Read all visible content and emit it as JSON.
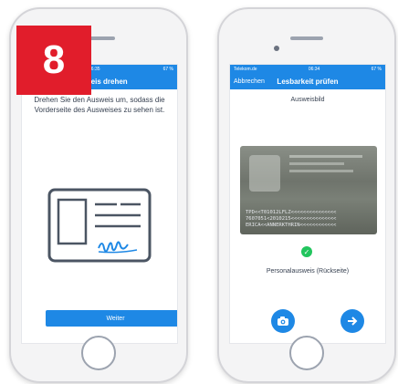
{
  "badge": {
    "number": "8"
  },
  "left": {
    "status": {
      "time": "06:35",
      "battery": "67 %"
    },
    "nav": {
      "title": "Ausweis drehen"
    },
    "instruction": "Drehen Sie den Ausweis um, sodass die Vorderseite des Ausweises zu sehen ist.",
    "button": {
      "label": "Weiter"
    }
  },
  "right": {
    "status": {
      "carrier": "Telekom.de",
      "time": "06:34",
      "battery": "67 %"
    },
    "nav": {
      "back": "Abbrechen",
      "title": "Lesbarkeit prüfen"
    },
    "section": "Ausweisbild",
    "mrz": "TPD<<T01012LFLZ<<<<<<<<<<<<<<<\n7607051<2010215<<<<<<<<<<<<<<<\nERICA<<ANNERKTHRIN<<<<<<<<<<<<",
    "document_type": "Personalausweis (Rückseite)"
  },
  "colors": {
    "accent": "#1e88e5",
    "badge": "#e11d2b",
    "success": "#22c55e"
  },
  "icons": [
    "camera-icon",
    "arrow-right-icon",
    "checkmark-icon",
    "id-card-icon"
  ]
}
